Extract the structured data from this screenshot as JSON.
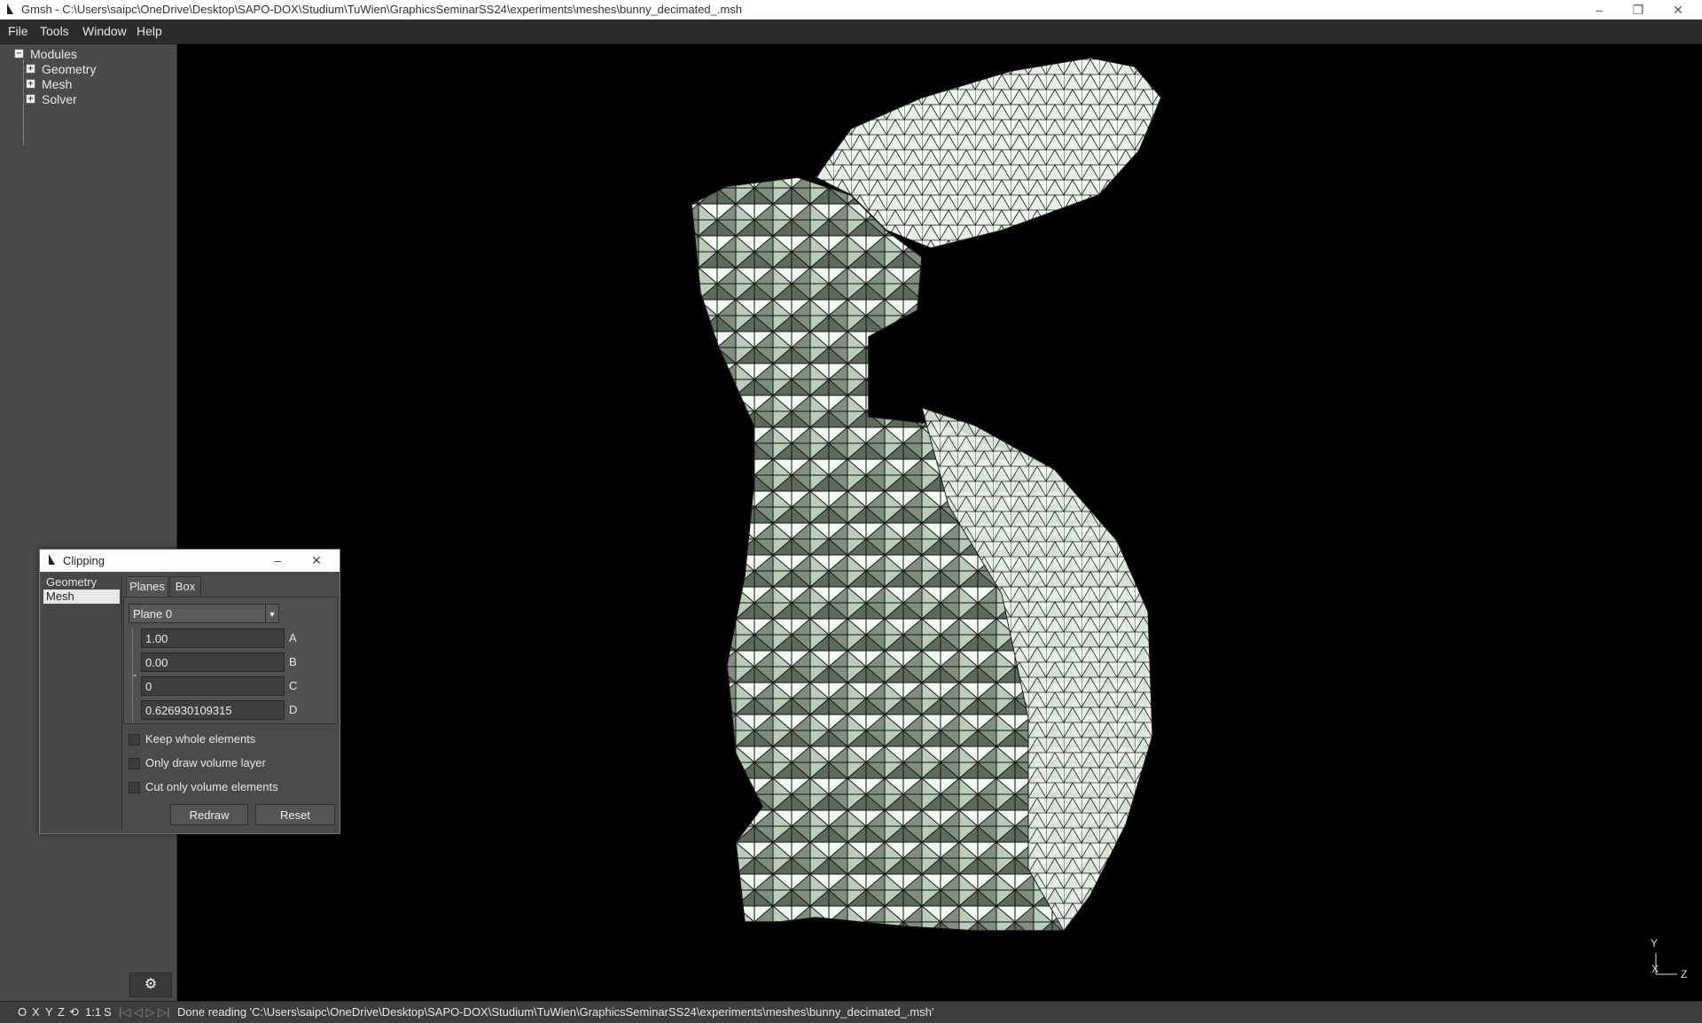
{
  "window": {
    "title": "Gmsh - C:\\Users\\saipc\\OneDrive\\Desktop\\SAPO-DOX\\Studium\\TuWien\\GraphicsSeminarSS24\\experiments\\meshes\\bunny_decimated_.msh",
    "minimize": "–",
    "restore": "❐",
    "close": "✕"
  },
  "menu": {
    "file": "File",
    "tools": "Tools",
    "window": "Window",
    "help": "Help"
  },
  "tree": {
    "root": "Modules",
    "items": [
      "Geometry",
      "Mesh",
      "Solver"
    ],
    "expand_glyph": "+",
    "collapse_glyph": "−"
  },
  "gear_button": "⚙",
  "status": {
    "buttons": [
      "O",
      "X",
      "Y",
      "Z",
      "⟲",
      "1:1",
      "S"
    ],
    "nav": "|◁ ◁ ▷ ▷|",
    "message": "Done reading 'C:\\Users\\saipc\\OneDrive\\Desktop\\SAPO-DOX\\Studium\\TuWien\\GraphicsSeminarSS24\\experiments\\meshes\\bunny_decimated_.msh'"
  },
  "axes": {
    "y": "Y",
    "x": "X",
    "z": "Z"
  },
  "clipping": {
    "title": "Clipping",
    "list": [
      "Geometry",
      "Mesh"
    ],
    "selected": "Mesh",
    "tabs": [
      "Planes",
      "Box"
    ],
    "plane": "Plane 0",
    "fields": [
      {
        "value": "1.00",
        "label": "A"
      },
      {
        "value": "0.00",
        "label": "B"
      },
      {
        "value": "0",
        "label": "C"
      },
      {
        "value": "0.626930109315",
        "label": "D"
      }
    ],
    "bracket_label": "-",
    "checkboxes": [
      "Keep whole elements",
      "Only draw volume layer",
      "Cut only volume elements"
    ],
    "redraw": "Redraw",
    "reset": "Reset"
  },
  "mesh_colors": {
    "light": "#e8f6e8",
    "mid": "#a9bfa9",
    "dark": "#5c6a5c",
    "edges": "#111111"
  }
}
